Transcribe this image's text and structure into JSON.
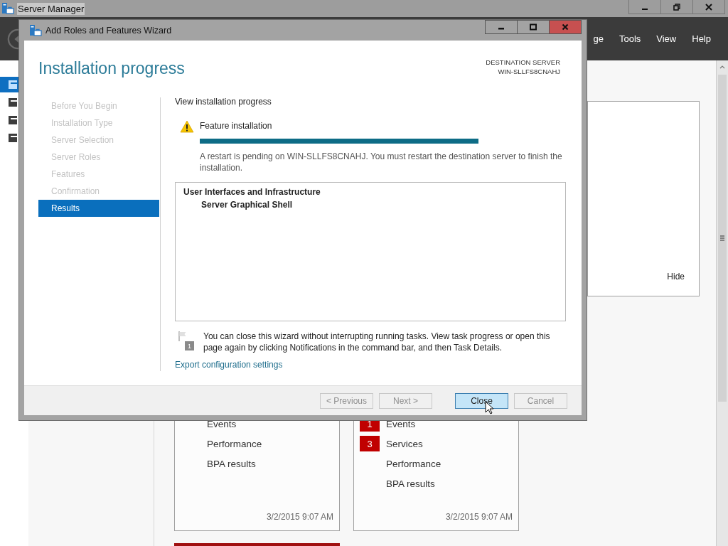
{
  "server_manager": {
    "title": "Server Manager",
    "menu": [
      {
        "label": "ge"
      },
      {
        "label": "Tools"
      },
      {
        "label": "View"
      },
      {
        "label": "Help"
      }
    ],
    "nav": [
      {
        "selected": true
      },
      {
        "selected": false
      },
      {
        "selected": false
      },
      {
        "selected": false
      }
    ],
    "side_panel": {
      "hide_label": "Hide"
    },
    "tiles": [
      {
        "items": [
          {
            "label": "Events"
          },
          {
            "label": "Performance"
          },
          {
            "label": "BPA results"
          }
        ],
        "timestamp": "3/2/2015 9:07 AM"
      },
      {
        "items": [
          {
            "label": "Events",
            "count": "1"
          },
          {
            "label": "Services",
            "count": "3"
          },
          {
            "label": "Performance"
          },
          {
            "label": "BPA results"
          }
        ],
        "timestamp": "3/2/2015 9:07 AM"
      }
    ]
  },
  "wizard": {
    "title": "Add Roles and Features Wizard",
    "heading": "Installation progress",
    "destination_label": "DESTINATION SERVER",
    "destination_server": "WIN-SLLFS8CNAHJ",
    "steps": [
      {
        "label": "Before You Begin",
        "selected": false
      },
      {
        "label": "Installation Type",
        "selected": false
      },
      {
        "label": "Server Selection",
        "selected": false
      },
      {
        "label": "Server Roles",
        "selected": false
      },
      {
        "label": "Features",
        "selected": false
      },
      {
        "label": "Confirmation",
        "selected": false
      },
      {
        "label": "Results",
        "selected": true
      }
    ],
    "section_label": "View installation progress",
    "task": {
      "label": "Feature installation",
      "level": 1,
      "message": "A restart is pending on WIN-SLLFS8CNAHJ. You must restart the destination server to finish the installation."
    },
    "results": [
      {
        "label": "User Interfaces and Infrastructure",
        "children": [
          {
            "label": "Server Graphical Shell"
          }
        ]
      }
    ],
    "note": "You can close this wizard without interrupting running tasks. View task progress or open this page again by clicking Notifications in the command bar, and then Task Details.",
    "note_badge": "1",
    "export_link": "Export configuration settings",
    "buttons": [
      {
        "label": "< Previous",
        "disabled": true,
        "default": false
      },
      {
        "label": "Next >",
        "disabled": true,
        "default": false
      },
      {
        "label": "Close",
        "disabled": false,
        "default": true
      },
      {
        "label": "Cancel",
        "disabled": true,
        "default": false
      }
    ]
  }
}
